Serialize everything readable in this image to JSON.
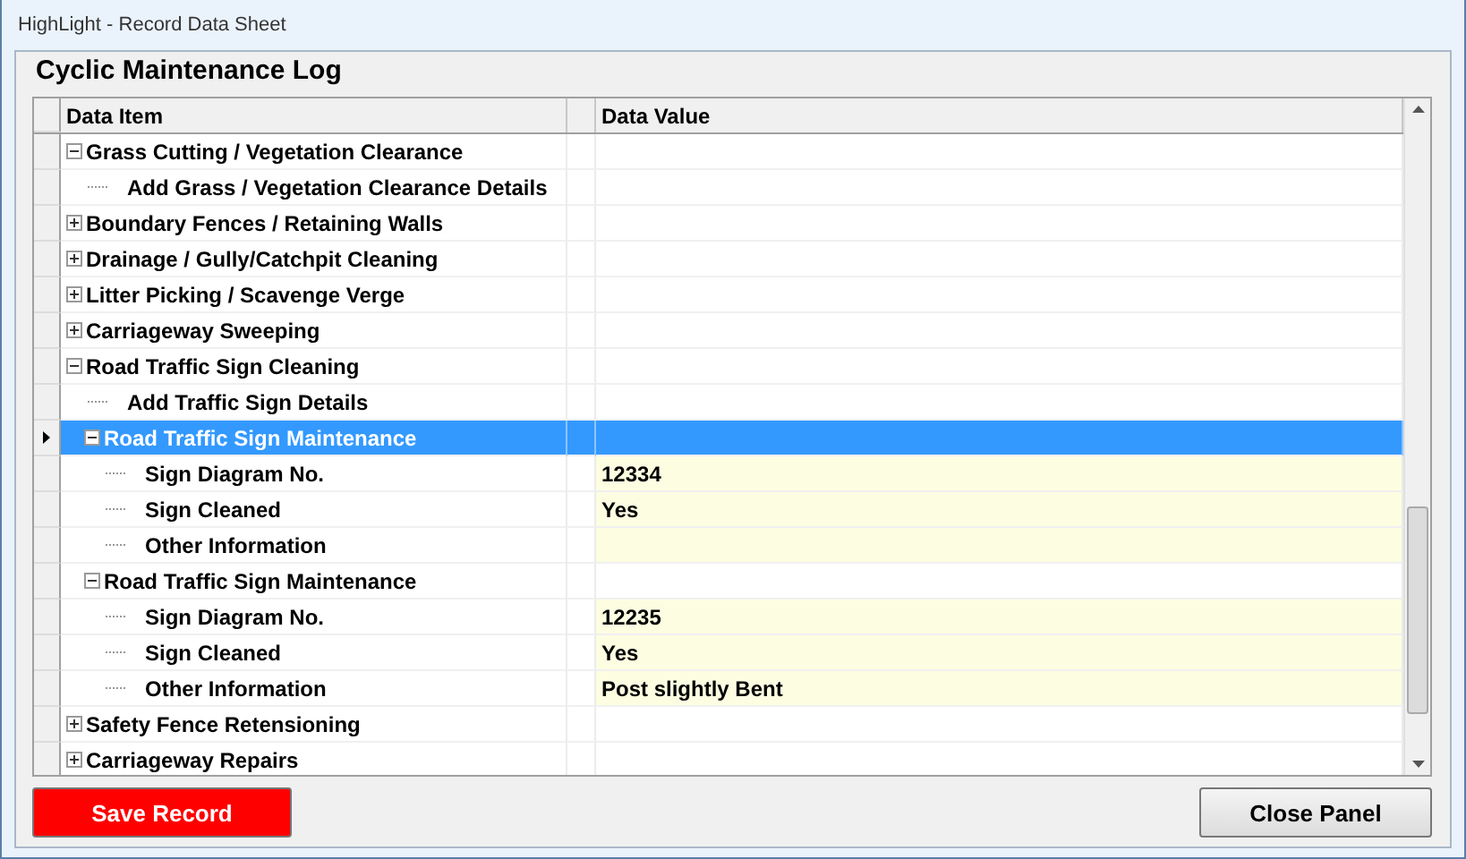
{
  "window": {
    "title": "HighLight - Record Data Sheet"
  },
  "heading": "Cyclic Maintenance Log",
  "table": {
    "columns": [
      "Data Item",
      "Data Value"
    ],
    "rows": [
      {
        "label": "Grass Cutting / Vegetation Clearance",
        "kind": "node",
        "expanded": true,
        "selected": false,
        "children": [
          {
            "label": "Add Grass / Vegetation Clearance Details",
            "kind": "leaf",
            "selected": false
          }
        ]
      },
      {
        "label": "Boundary Fences / Retaining Walls",
        "kind": "node",
        "expanded": false,
        "selected": false
      },
      {
        "label": "Drainage / Gully/Catchpit Cleaning",
        "kind": "node",
        "expanded": false,
        "selected": false
      },
      {
        "label": "Litter Picking / Scavenge Verge",
        "kind": "node",
        "expanded": false,
        "selected": false
      },
      {
        "label": "Carriageway Sweeping",
        "kind": "node",
        "expanded": false,
        "selected": false
      },
      {
        "label": "Road Traffic Sign Cleaning",
        "kind": "node",
        "expanded": true,
        "selected": false,
        "children": [
          {
            "label": "Add Traffic Sign Details",
            "kind": "leaf",
            "selected": false
          },
          {
            "label": "Road Traffic Sign Maintenance",
            "kind": "node",
            "expanded": true,
            "selected": true,
            "children": [
              {
                "label": "Sign Diagram No.",
                "kind": "field",
                "value": "12334",
                "selected": false
              },
              {
                "label": "Sign Cleaned",
                "kind": "field",
                "value": "Yes",
                "selected": false
              },
              {
                "label": "Other Information",
                "kind": "field",
                "selected": false
              }
            ]
          },
          {
            "label": "Road Traffic Sign Maintenance",
            "kind": "node",
            "expanded": true,
            "selected": false,
            "children": [
              {
                "label": "Sign Diagram No.",
                "kind": "field",
                "value": "12235",
                "selected": false
              },
              {
                "label": "Sign Cleaned",
                "kind": "field",
                "value": "Yes",
                "selected": false
              },
              {
                "label": "Other Information",
                "kind": "field",
                "value": "Post slightly Bent",
                "selected": false
              }
            ]
          }
        ]
      },
      {
        "label": "Safety Fence Retensioning",
        "kind": "node",
        "expanded": false,
        "selected": false
      },
      {
        "label": "Carriageway Repairs",
        "kind": "node",
        "expanded": false,
        "selected": false
      }
    ]
  },
  "buttons": {
    "save": "Save Record",
    "close": "Close Panel"
  }
}
